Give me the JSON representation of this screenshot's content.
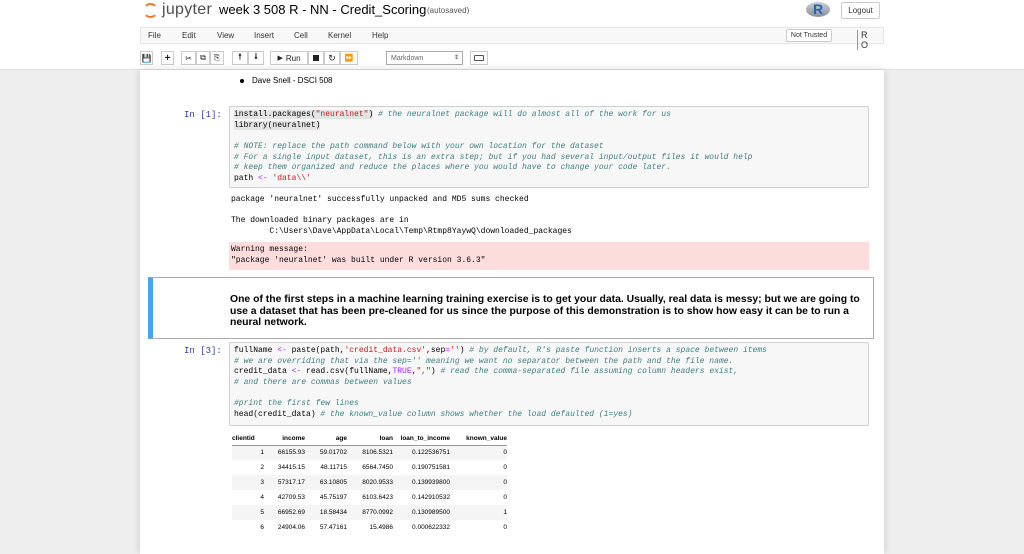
{
  "header": {
    "logo_text": "jupyter",
    "notebook_name": "week 3 508 R - NN - Credit_Scoring",
    "autosave_status": "(autosaved)",
    "kernel_logo_letter": "R",
    "logout_label": "Logout"
  },
  "menubar": {
    "items": [
      "File",
      "Edit",
      "View",
      "Insert",
      "Cell",
      "Kernel",
      "Help"
    ],
    "trusted_label": "Not Trusted",
    "kernel_indicator": "R O"
  },
  "toolbar": {
    "run_label": "Run",
    "cell_type": "Markdown"
  },
  "cells": {
    "top_bullet": "Dave Snell - DSCI 508",
    "cell1": {
      "prompt": "In [1]:",
      "output_lines": [
        "package 'neuralnet' successfully unpacked and MD5 sums checked",
        "",
        "The downloaded binary packages are in",
        "        C:\\Users\\Dave\\AppData\\Local\\Temp\\Rtmp8YaywQ\\downloaded_packages"
      ],
      "warning_lines": [
        "Warning message:",
        "\"package 'neuralnet' was built under R version 3.6.3\""
      ]
    },
    "markdown": "One of the first steps in a machine learning training exercise is to get your data. Usually, real data is messy; but we are going to use a dataset that has been pre-cleaned for us since the purpose of this demonstration is to show how easy it can be to run a neural network.",
    "cell3": {
      "prompt": "In [3]:"
    }
  },
  "table": {
    "columns": [
      "clientid",
      "income",
      "age",
      "loan",
      "loan_to_income",
      "known_value"
    ],
    "rows": [
      [
        "1",
        "66155.93",
        "59.01702",
        "8106.5321",
        "0.122536751",
        "0"
      ],
      [
        "2",
        "34415.15",
        "48.11715",
        "6564.7450",
        "0.190751581",
        "0"
      ],
      [
        "3",
        "57317.17",
        "63.10805",
        "8020.9533",
        "0.139939800",
        "0"
      ],
      [
        "4",
        "42709.53",
        "45.75197",
        "6103.6423",
        "0.142910532",
        "0"
      ],
      [
        "5",
        "66952.69",
        "18.58434",
        "8770.0992",
        "0.130989500",
        "1"
      ],
      [
        "6",
        "24904.06",
        "57.47161",
        "15.4986",
        "0.000622332",
        "0"
      ]
    ]
  },
  "colors": {
    "jupyter_orange": "#f37726",
    "prompt_blue": "#303f9f",
    "selected_cell_border": "#42a5f5",
    "stderr_bg": "#ffdddd",
    "comment": "#408080",
    "string": "#ba2121",
    "operator": "#aa22ff"
  },
  "icons": [
    "save-icon",
    "add-cell-icon",
    "cut-icon",
    "copy-icon",
    "paste-icon",
    "move-up-icon",
    "move-down-icon",
    "run-icon",
    "stop-icon",
    "restart-icon",
    "fast-forward-icon",
    "keyboard-icon"
  ]
}
